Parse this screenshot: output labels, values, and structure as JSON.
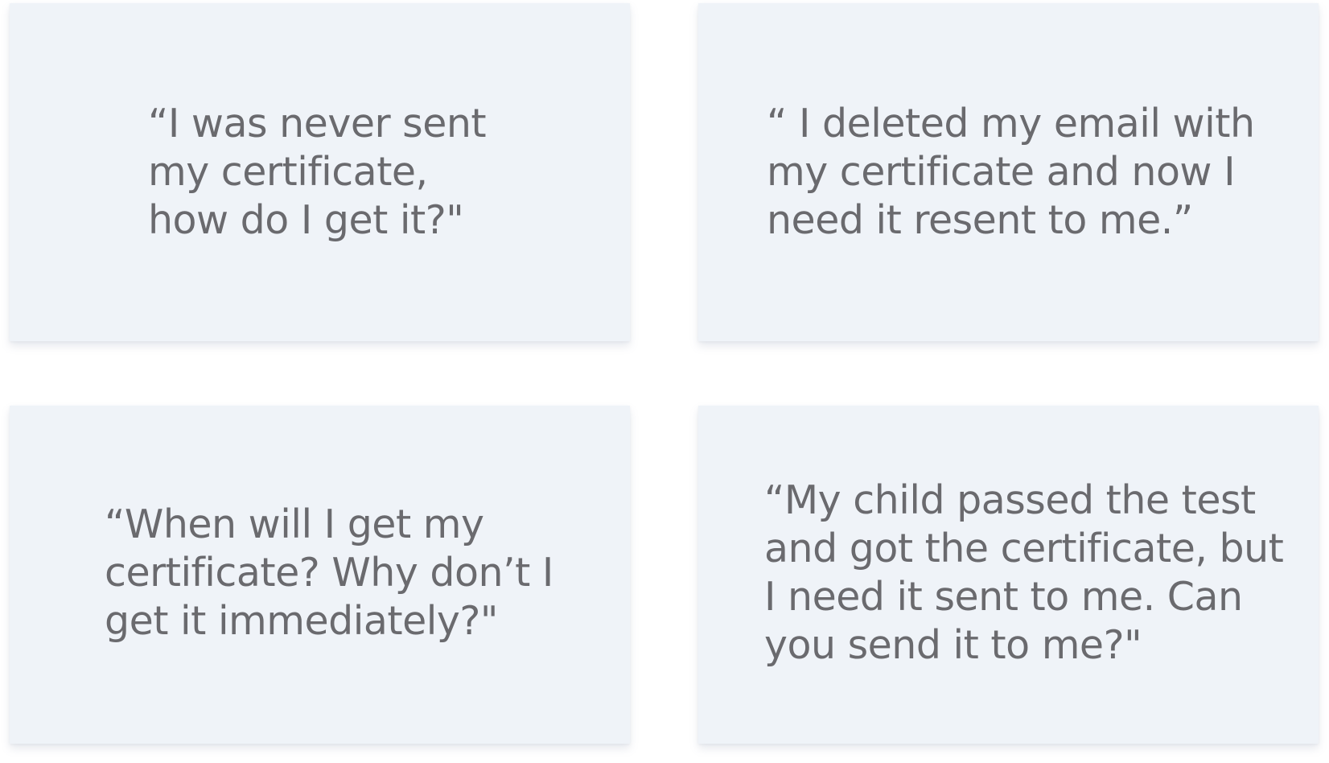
{
  "cards": [
    {
      "lines": [
        "“I was never sent",
        "my certificate,",
        "how do I get it?\""
      ]
    },
    {
      "lines": [
        "“ I deleted my email with",
        "my certificate and now I",
        "need it resent to me.”"
      ]
    },
    {
      "lines": [
        "“When will I get my",
        "certificate? Why don’t I",
        "get it immediately?\""
      ]
    },
    {
      "lines": [
        "“My child passed the test",
        "and got the certificate, but",
        "I need it sent to me. Can",
        "you send it to me?\""
      ]
    }
  ]
}
